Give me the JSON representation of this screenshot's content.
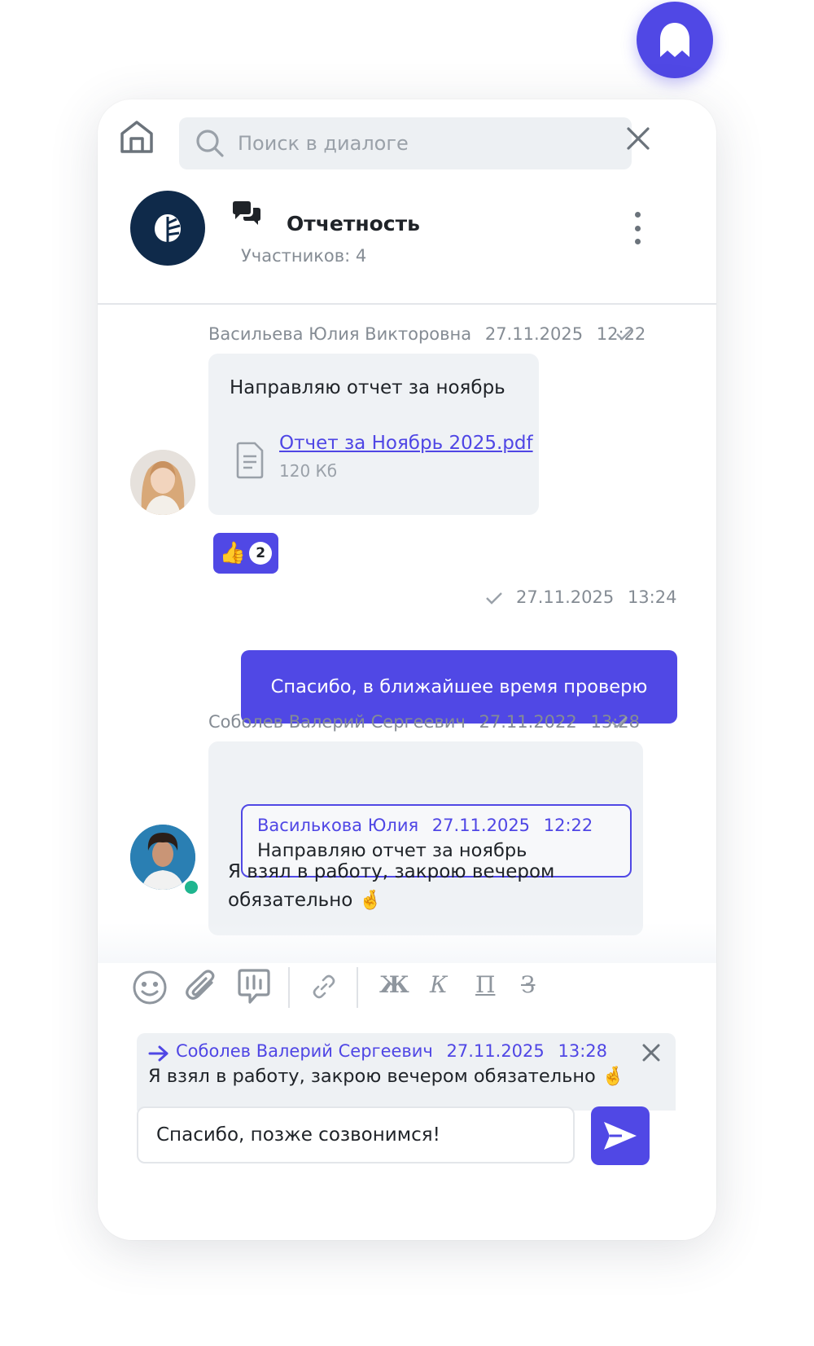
{
  "colors": {
    "accent": "#5048e5",
    "bubble": "#eff2f5",
    "muted": "#858c94",
    "online": "#1fb58f"
  },
  "search": {
    "placeholder": "Поиск в диалоге"
  },
  "chat": {
    "title": "Отчетность",
    "participants": "Участников: 4"
  },
  "messages": [
    {
      "author": "Васильева Юлия Викторовна",
      "date": "27.11.2025",
      "time": "12:22",
      "text": "Направляю отчет за ноябрь",
      "attachment": {
        "name": "Отчет за Ноябрь 2025.pdf",
        "size": "120 Кб"
      },
      "reaction": {
        "emoji": "👍",
        "count": "2"
      }
    },
    {
      "date": "27.11.2025",
      "time": "13:24",
      "text": "Спасибо, в ближайшее время проверю"
    },
    {
      "author": "Соболев Валерий Сергеевич",
      "date": "27.11.2022",
      "time": "13:28",
      "quote": {
        "author": "Василькова Юлия",
        "date": "27.11.2025",
        "time": "12:22",
        "text": "Направляю отчет за ноябрь"
      },
      "text_line1": "Я взял в работу, закрою вечером",
      "text_line2": "обязательно 🤞"
    }
  ],
  "toolbar": {
    "bold": "Ж",
    "italic": "К",
    "underline": "П",
    "strike": "З"
  },
  "reply": {
    "author": "Соболев Валерий Сергеевич",
    "date": "27.11.2025",
    "time": "13:28",
    "text": "Я взял в работу, закрою вечером обязательно 🤞"
  },
  "composer": {
    "value": "Спасибо, позже созвонимся!"
  }
}
